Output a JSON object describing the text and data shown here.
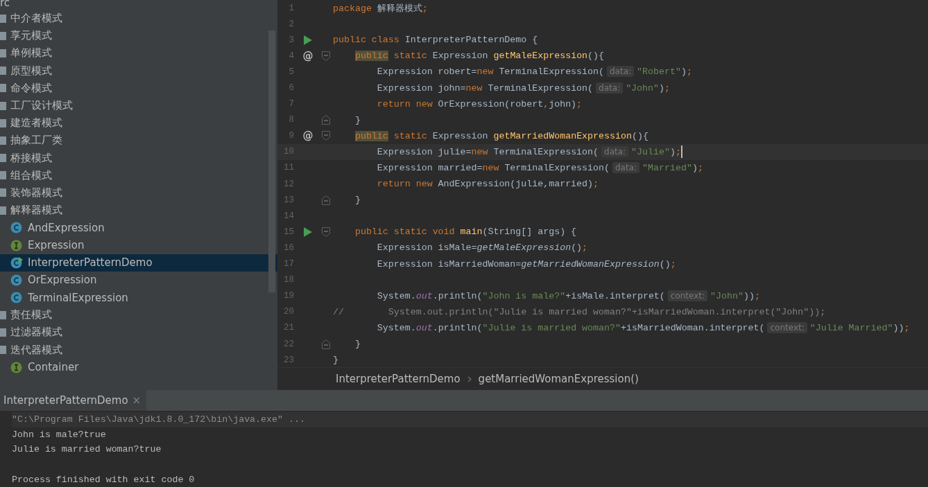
{
  "sidebar": {
    "header": "rc",
    "items": [
      {
        "kind": "folder",
        "label": "中介者模式",
        "selected": false
      },
      {
        "kind": "folder",
        "label": "享元模式",
        "selected": false
      },
      {
        "kind": "folder",
        "label": "单例模式",
        "selected": false
      },
      {
        "kind": "folder",
        "label": "原型模式",
        "selected": false
      },
      {
        "kind": "folder",
        "label": "命令模式",
        "selected": false
      },
      {
        "kind": "folder",
        "label": "工厂设计模式",
        "selected": false
      },
      {
        "kind": "folder",
        "label": "建造者模式",
        "selected": false
      },
      {
        "kind": "folder",
        "label": "抽象工厂类",
        "selected": false
      },
      {
        "kind": "folder",
        "label": "桥接模式",
        "selected": false
      },
      {
        "kind": "folder",
        "label": "组合模式",
        "selected": false
      },
      {
        "kind": "folder",
        "label": "装饰器模式",
        "selected": false
      },
      {
        "kind": "folder",
        "label": "解释器模式",
        "selected": false,
        "children": [
          {
            "kind": "class",
            "label": "AndExpression",
            "selected": false,
            "runnable": false
          },
          {
            "kind": "interface",
            "label": "Expression",
            "selected": false,
            "runnable": false
          },
          {
            "kind": "class",
            "label": "InterpreterPatternDemo",
            "selected": true,
            "runnable": true
          },
          {
            "kind": "class",
            "label": "OrExpression",
            "selected": false,
            "runnable": false
          },
          {
            "kind": "class",
            "label": "TerminalExpression",
            "selected": false,
            "runnable": false
          }
        ]
      },
      {
        "kind": "folder",
        "label": "责任模式",
        "selected": false
      },
      {
        "kind": "folder",
        "label": "过滤器模式",
        "selected": false
      },
      {
        "kind": "folder",
        "label": "迭代器模式",
        "selected": false,
        "children": [
          {
            "kind": "interface",
            "label": "Container",
            "selected": false,
            "runnable": false
          }
        ]
      }
    ]
  },
  "editor": {
    "lines": [
      {
        "number": "1",
        "tokens": [
          {
            "kind": "k",
            "text": "package"
          },
          {
            "kind": "t",
            "text": " 解释器模式"
          },
          {
            "kind": "p",
            "text": ";"
          }
        ]
      },
      {
        "number": "2"
      },
      {
        "number": "3",
        "marker": {
          "kind": "run"
        },
        "tokens": [
          {
            "kind": "k",
            "text": "public class "
          },
          {
            "kind": "t",
            "text": "InterpreterPatternDemo {"
          }
        ]
      },
      {
        "number": "4",
        "marker": {
          "kind": "symbol",
          "text": "@"
        },
        "fold": {
          "kind": "start"
        },
        "tokens": [
          {
            "kind": "km",
            "text": "    public"
          },
          {
            "kind": "k",
            "text": " static "
          },
          {
            "kind": "t",
            "text": "Expression "
          },
          {
            "kind": "m",
            "text": "getMaleExpression"
          },
          {
            "kind": "t",
            "text": "(){"
          }
        ]
      },
      {
        "number": "5",
        "tokens": [
          {
            "kind": "t",
            "text": "        Expression robert="
          },
          {
            "kind": "k",
            "text": "new "
          },
          {
            "kind": "t",
            "text": "TerminalExpression("
          },
          {
            "kind": "h",
            "text": "data:"
          },
          {
            "kind": "s",
            "text": "\"Robert\""
          },
          {
            "kind": "t",
            "text": ")"
          },
          {
            "kind": "p",
            "text": ";"
          }
        ]
      },
      {
        "number": "6",
        "tokens": [
          {
            "kind": "t",
            "text": "        Expression john="
          },
          {
            "kind": "k",
            "text": "new "
          },
          {
            "kind": "t",
            "text": "TerminalExpression("
          },
          {
            "kind": "h",
            "text": "data:"
          },
          {
            "kind": "s",
            "text": "\"John\""
          },
          {
            "kind": "t",
            "text": ")"
          },
          {
            "kind": "p",
            "text": ";"
          }
        ]
      },
      {
        "number": "7",
        "tokens": [
          {
            "kind": "k",
            "text": "        return new "
          },
          {
            "kind": "t",
            "text": "OrExpression(robert"
          },
          {
            "kind": "p",
            "text": ","
          },
          {
            "kind": "t",
            "text": "john)"
          },
          {
            "kind": "p",
            "text": ";"
          }
        ]
      },
      {
        "number": "8",
        "fold": {
          "kind": "end"
        },
        "tokens": [
          {
            "kind": "t",
            "text": "    }"
          }
        ]
      },
      {
        "number": "9",
        "marker": {
          "kind": "symbol",
          "text": "@"
        },
        "fold": {
          "kind": "start"
        },
        "tokens": [
          {
            "kind": "km",
            "text": "    public"
          },
          {
            "kind": "k",
            "text": " static "
          },
          {
            "kind": "t",
            "text": "Expression "
          },
          {
            "kind": "m",
            "text": "getMarriedWomanExpression"
          },
          {
            "kind": "t",
            "text": "(){"
          }
        ]
      },
      {
        "number": "10",
        "current": true,
        "tokens": [
          {
            "kind": "t",
            "text": "        Expression julie="
          },
          {
            "kind": "k",
            "text": "new "
          },
          {
            "kind": "t",
            "text": "TerminalExpression("
          },
          {
            "kind": "h",
            "text": "data:"
          },
          {
            "kind": "s",
            "text": "\"Julie\""
          },
          {
            "kind": "t",
            "text": ")"
          },
          {
            "kind": "p",
            "text": ";"
          }
        ]
      },
      {
        "number": "11",
        "tokens": [
          {
            "kind": "t",
            "text": "        Expression married="
          },
          {
            "kind": "k",
            "text": "new "
          },
          {
            "kind": "t",
            "text": "TerminalExpression("
          },
          {
            "kind": "h",
            "text": "data:"
          },
          {
            "kind": "s",
            "text": "\"Married\""
          },
          {
            "kind": "t",
            "text": ")"
          },
          {
            "kind": "p",
            "text": ";"
          }
        ]
      },
      {
        "number": "12",
        "tokens": [
          {
            "kind": "k",
            "text": "        return new "
          },
          {
            "kind": "t",
            "text": "AndExpression(julie,married)"
          },
          {
            "kind": "p",
            "text": ";"
          }
        ]
      },
      {
        "number": "13",
        "fold": {
          "kind": "end"
        },
        "tokens": [
          {
            "kind": "t",
            "text": "    }"
          }
        ]
      },
      {
        "number": "14"
      },
      {
        "number": "15",
        "marker": {
          "kind": "run"
        },
        "fold": {
          "kind": "start"
        },
        "tokens": [
          {
            "kind": "k",
            "text": "    public static void "
          },
          {
            "kind": "m",
            "text": "main"
          },
          {
            "kind": "t",
            "text": "(String[] args) {"
          }
        ]
      },
      {
        "number": "16",
        "tokens": [
          {
            "kind": "t",
            "text": "        Expression isMale="
          },
          {
            "kind": "i",
            "text": "getMaleExpression"
          },
          {
            "kind": "t",
            "text": "()"
          },
          {
            "kind": "p",
            "text": ";"
          }
        ]
      },
      {
        "number": "17",
        "tokens": [
          {
            "kind": "t",
            "text": "        Expression isMarriedWoman="
          },
          {
            "kind": "i",
            "text": "getMarriedWomanExpression"
          },
          {
            "kind": "t",
            "text": "()"
          },
          {
            "kind": "p",
            "text": ";"
          }
        ]
      },
      {
        "number": "18"
      },
      {
        "number": "19",
        "tokens": [
          {
            "kind": "t",
            "text": "        System."
          },
          {
            "kind": "f",
            "text": "out"
          },
          {
            "kind": "t",
            "text": ".println("
          },
          {
            "kind": "s",
            "text": "\"John is male?\""
          },
          {
            "kind": "t",
            "text": "+isMale.interpret("
          },
          {
            "kind": "h",
            "text": "context:"
          },
          {
            "kind": "s",
            "text": "\"John\""
          },
          {
            "kind": "t",
            "text": "))"
          },
          {
            "kind": "p",
            "text": ";"
          }
        ]
      },
      {
        "number": "20",
        "tokens": [
          {
            "kind": "c",
            "text": "//        System.out.println(\"Julie is married woman?\"+isMarriedWoman.interpret(\"John\"));"
          }
        ]
      },
      {
        "number": "21",
        "tokens": [
          {
            "kind": "t",
            "text": "        System."
          },
          {
            "kind": "f",
            "text": "out"
          },
          {
            "kind": "t",
            "text": ".println("
          },
          {
            "kind": "s",
            "text": "\"Julie is married woman?\""
          },
          {
            "kind": "t",
            "text": "+isMarriedWoman.interpret("
          },
          {
            "kind": "h",
            "text": "context:"
          },
          {
            "kind": "s",
            "text": "\"Julie Married\""
          },
          {
            "kind": "t",
            "text": "))"
          },
          {
            "kind": "p",
            "text": ";"
          }
        ]
      },
      {
        "number": "22",
        "fold": {
          "kind": "end"
        },
        "tokens": [
          {
            "kind": "t",
            "text": "    }"
          }
        ]
      },
      {
        "number": "23",
        "tokens": [
          {
            "kind": "t",
            "text": "}"
          }
        ]
      }
    ]
  },
  "breadcrumb": [
    "InterpreterPatternDemo",
    "getMarriedWomanExpression()"
  ],
  "run_panel": {
    "tabs": [
      {
        "label": "InterpreterPatternDemo",
        "close": "×",
        "selected": true
      }
    ],
    "console": [
      {
        "kind": "command",
        "text": "\"C:\\Program Files\\Java\\jdk1.8.0_172\\bin\\java.exe\" ..."
      },
      {
        "kind": "output",
        "text": "John is male?true"
      },
      {
        "kind": "output",
        "text": "Julie is married woman?true"
      },
      {
        "kind": "blank"
      },
      {
        "kind": "output",
        "text": "Process finished with exit code 0"
      }
    ]
  }
}
